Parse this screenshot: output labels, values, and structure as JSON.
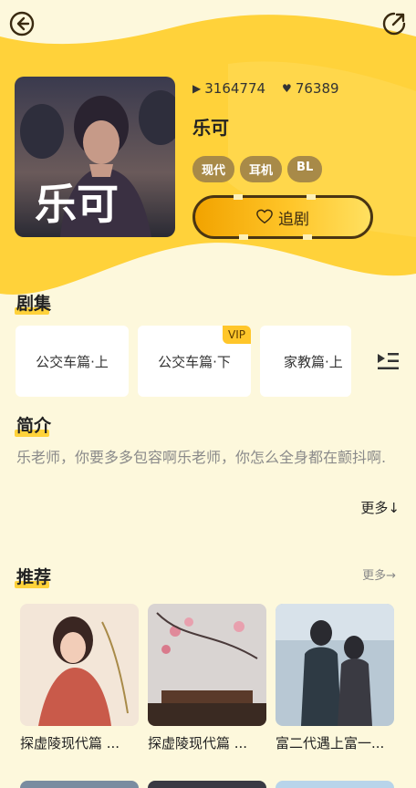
{
  "stats": {
    "plays": "3164774",
    "likes": "76389"
  },
  "drama": {
    "title": "乐可",
    "cover_text": "乐可",
    "tags": [
      "现代",
      "耳机",
      "BL"
    ],
    "follow_label": "追剧"
  },
  "episodes_section": {
    "title": "剧集",
    "items": [
      {
        "label": "公交车篇·上",
        "badge": ""
      },
      {
        "label": "公交车篇·下",
        "badge": "VIP"
      },
      {
        "label": "家教篇·上",
        "badge": ""
      }
    ]
  },
  "intro_section": {
    "title": "简介",
    "text": "乐老师，你要多多包容啊乐老师，你怎么全身都在颤抖啊.",
    "more_label": "更多↓"
  },
  "recommend_section": {
    "title": "推荐",
    "more_label": "更多→",
    "items": [
      {
        "title": "探虚陵现代篇 ..."
      },
      {
        "title": "探虚陵现代篇 ..."
      },
      {
        "title": "富二代遇上富一..."
      }
    ]
  },
  "colors": {
    "accent": "#ffd23a",
    "background": "#fdf8dc",
    "tag": "#a88a48"
  },
  "icons": [
    "back-icon",
    "share-icon",
    "play-icon",
    "heart-icon",
    "heart-outline-icon",
    "playlist-icon"
  ]
}
